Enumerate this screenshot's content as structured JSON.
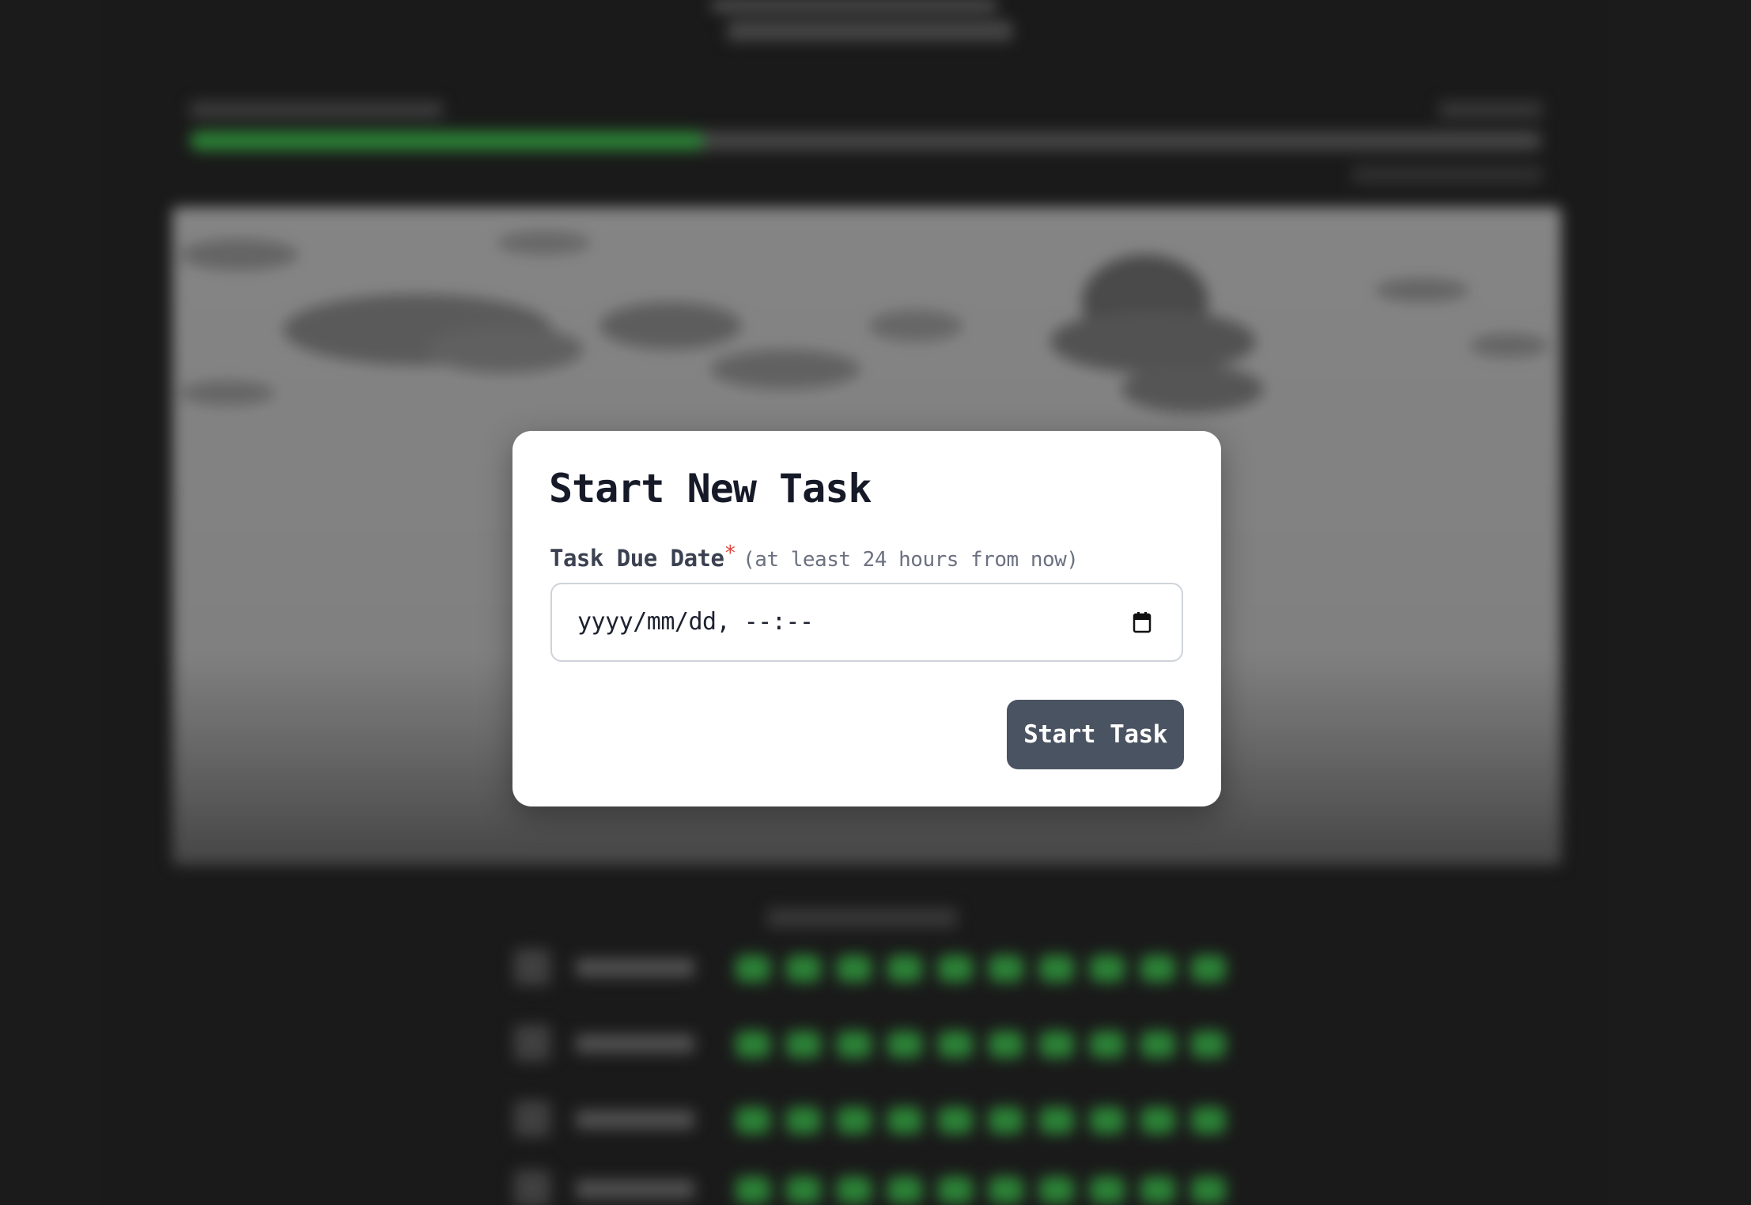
{
  "modal": {
    "title": "Start New Task",
    "field_label": "Task Due Date",
    "required_mark": "*",
    "field_hint": "(at least 24 hours from now)",
    "date_input_placeholder": "yyyy/mm/dd, --:--",
    "submit_label": "Start Task",
    "calendar_icon": "calendar-icon"
  },
  "background": {
    "progress_fill_fraction": 0.38,
    "progress_color": "#2f8a3a",
    "stat_rows": 4,
    "stat_dots_per_row": 10
  }
}
